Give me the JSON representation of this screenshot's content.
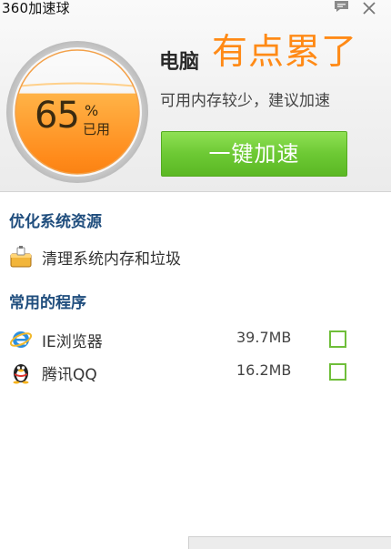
{
  "window": {
    "title": "360加速球"
  },
  "gauge": {
    "percent": "65",
    "percent_sign": "%",
    "used_label": "已用",
    "level": 0.65
  },
  "status": {
    "prefix": "电脑",
    "main": "有点累了",
    "sub": "可用内存较少，建议加速",
    "button_label": "一键加速"
  },
  "optimize": {
    "title": "优化系统资源",
    "items": [
      {
        "label": "清理系统内存和垃圾",
        "icon": "broom-bucket-icon"
      }
    ]
  },
  "programs": {
    "title": "常用的程序",
    "items": [
      {
        "label": "IE浏览器",
        "size": "39.7MB",
        "icon": "ie-icon"
      },
      {
        "label": "腾讯QQ",
        "size": "16.2MB",
        "icon": "qq-penguin-icon"
      }
    ]
  },
  "colors": {
    "accent_orange": "#ff8a16",
    "button_green": "#6dc934",
    "section_blue": "#1f4d7d",
    "checkbox_green": "#6fbe3a"
  }
}
